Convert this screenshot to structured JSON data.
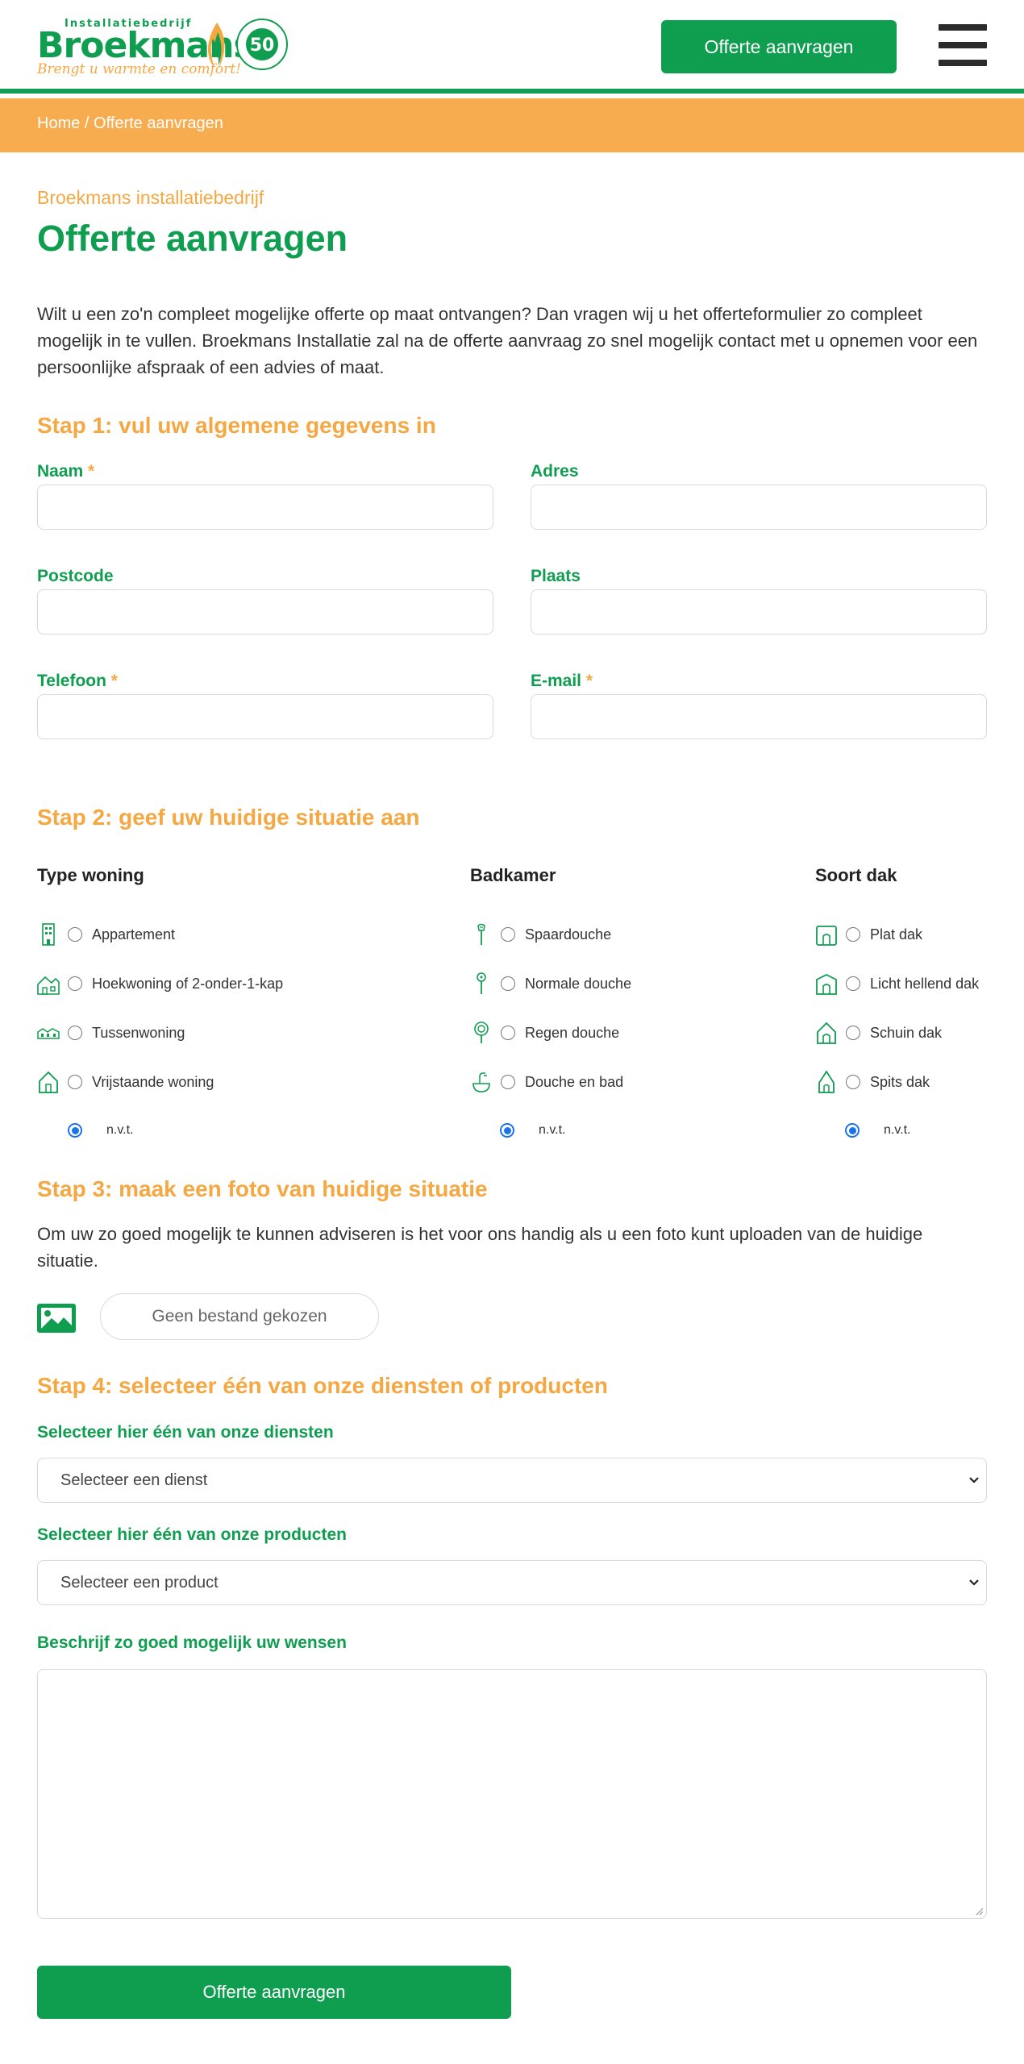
{
  "header": {
    "logo_top": "Installatiebedrijf",
    "logo_main": "Broekmans",
    "logo_tagline": "Brengt u warmte en comfort!",
    "seal_text": "50",
    "cta_label": "Offerte aanvragen",
    "menu_icon": "hamburger-icon"
  },
  "breadcrumb": {
    "text": "Home / Offerte aanvragen"
  },
  "page": {
    "subtitle": "Broekmans installatiebedrijf",
    "title": "Offerte aanvragen",
    "intro": "Wilt u een zo'n compleet mogelijke offerte op maat ontvangen? Dan vragen wij u het offerteformulier zo compleet mogelijk in te vullen. Broekmans Installatie zal na de offerte aanvraag zo snel mogelijk contact met u opnemen voor een persoonlijke afspraak of een advies of maat."
  },
  "step1": {
    "title": "Stap 1: vul uw algemene gegevens in",
    "required_mark": "*",
    "fields": {
      "naam": "Naam",
      "adres": "Adres",
      "postcode": "Postcode",
      "plaats": "Plaats",
      "telefoon": "Telefoon",
      "email": "E-mail"
    }
  },
  "step2": {
    "title": "Stap 2: geef uw huidige situatie aan",
    "columns": [
      {
        "heading": "Type woning",
        "options": [
          "Appartement",
          "Hoekwoning of 2-onder-1-kap",
          "Tussenwoning",
          "Vrijstaande woning"
        ],
        "icons": [
          "apartment-icon",
          "corner-house-icon",
          "terraced-house-icon",
          "detached-house-icon"
        ],
        "selected": "n.v.t."
      },
      {
        "heading": "Badkamer",
        "options": [
          "Spaardouche",
          "Normale douche",
          "Regen douche",
          "Douche en bad"
        ],
        "icons": [
          "eco-shower-icon",
          "shower-icon",
          "rain-shower-icon",
          "shower-bath-icon"
        ],
        "selected": "n.v.t."
      },
      {
        "heading": "Soort dak",
        "options": [
          "Plat dak",
          "Licht hellend dak",
          "Schuin dak",
          "Spits dak"
        ],
        "icons": [
          "flat-roof-icon",
          "low-pitch-roof-icon",
          "pitched-roof-icon",
          "steep-roof-icon"
        ],
        "selected": "n.v.t."
      }
    ],
    "nvt_label": "n.v.t."
  },
  "step3": {
    "title": "Stap 3: maak een foto van huidige situatie",
    "text": "Om uw zo goed mogelijk te kunnen adviseren is het voor ons handig als u een foto kunt uploaden van de huidige situatie.",
    "file_label": "Geen bestand gekozen"
  },
  "step4": {
    "title": "Stap 4: selecteer één van onze diensten of producten",
    "service_label": "Selecteer hier één van onze diensten",
    "service_value": "Selecteer een dienst",
    "product_label": "Selecteer hier één van onze producten",
    "product_value": "Selecteer een product",
    "wishes_label": "Beschrijf zo goed mogelijk uw wensen"
  },
  "submit_label": "Offerte aanvragen",
  "colors": {
    "green": "#0f9d4f",
    "orange": "#f5a842",
    "bar": "#f7ac4f"
  }
}
